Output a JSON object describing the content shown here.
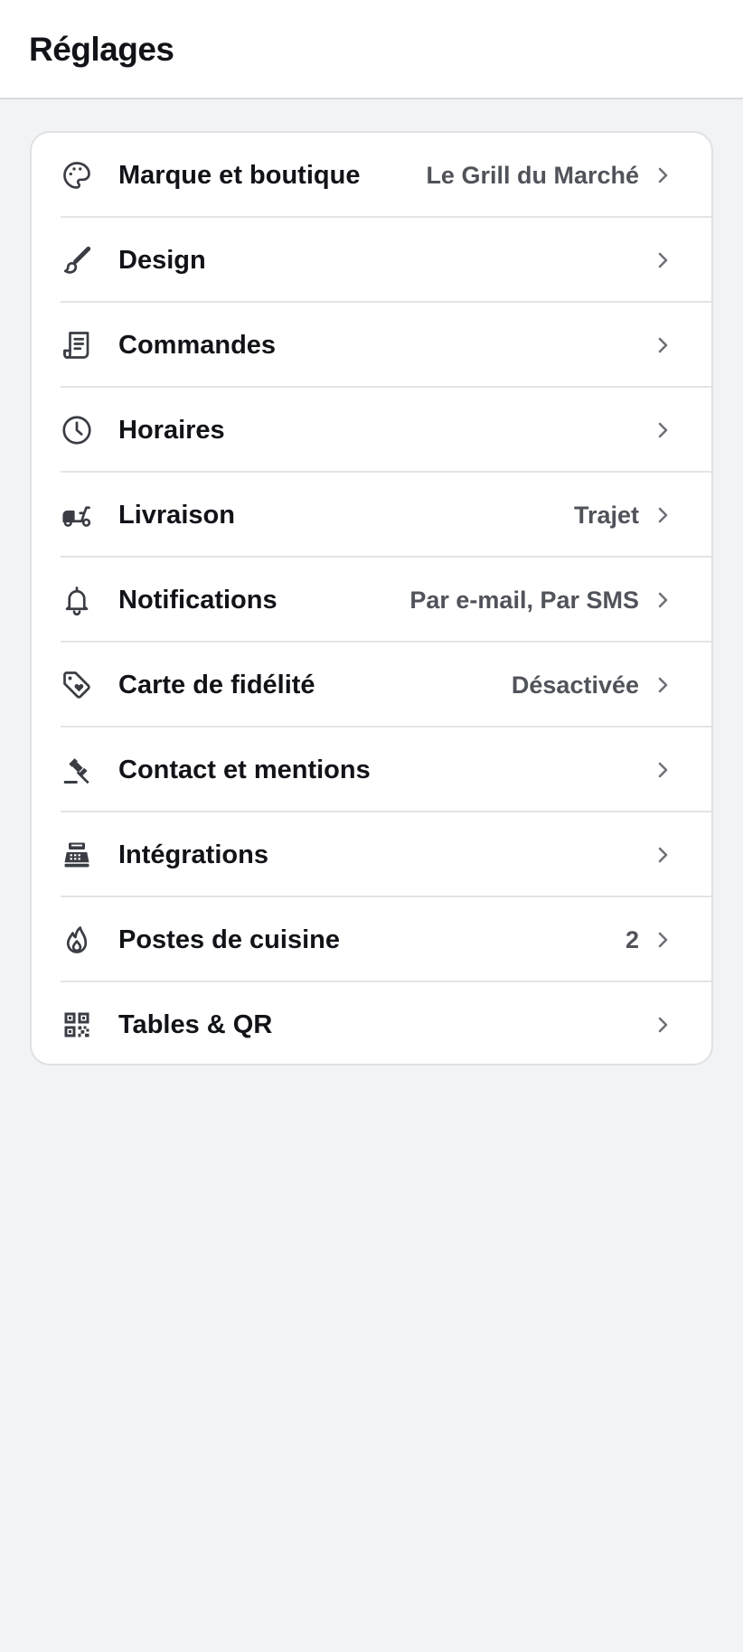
{
  "header": {
    "title": "Réglages"
  },
  "settings": {
    "items": [
      {
        "label": "Marque et boutique",
        "value": "Le Grill du Marché",
        "icon": "palette-icon"
      },
      {
        "label": "Design",
        "value": "",
        "icon": "brush-icon"
      },
      {
        "label": "Commandes",
        "value": "",
        "icon": "receipt-icon"
      },
      {
        "label": "Horaires",
        "value": "",
        "icon": "clock-icon"
      },
      {
        "label": "Livraison",
        "value": "Trajet",
        "icon": "scooter-icon"
      },
      {
        "label": "Notifications",
        "value": "Par e-mail, Par SMS",
        "icon": "bell-icon"
      },
      {
        "label": "Carte de fidélité",
        "value": "Désactivée",
        "icon": "loyalty-tag-icon"
      },
      {
        "label": "Contact et mentions",
        "value": "",
        "icon": "gavel-icon"
      },
      {
        "label": "Intégrations",
        "value": "",
        "icon": "cash-register-icon"
      },
      {
        "label": "Postes de cuisine",
        "value": "2",
        "icon": "flame-icon"
      },
      {
        "label": "Tables & QR",
        "value": "",
        "icon": "qr-code-icon"
      }
    ]
  }
}
